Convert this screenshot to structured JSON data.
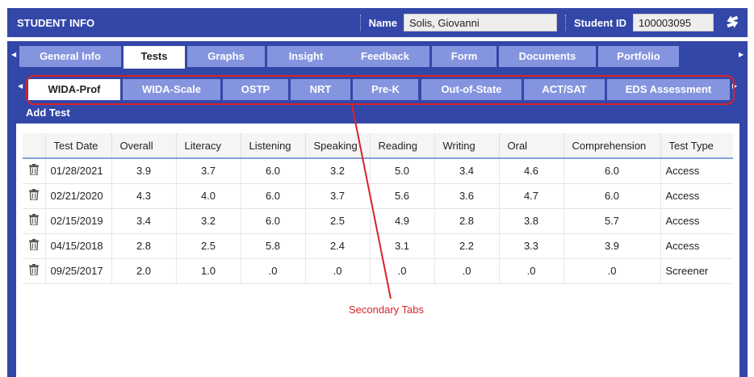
{
  "header": {
    "title": "STUDENT INFO",
    "name_label": "Name",
    "name_value": "Solis, Giovanni",
    "id_label": "Student ID",
    "id_value": "100003095",
    "swap_icon": "swap-icon"
  },
  "outer_tabs": [
    {
      "label": "General Info"
    },
    {
      "label": "Tests"
    },
    {
      "label": "Graphs"
    },
    {
      "label": "Insight"
    },
    {
      "label": "Feedback"
    },
    {
      "label": "Form"
    },
    {
      "label": "Documents"
    },
    {
      "label": "Portfolio"
    }
  ],
  "secondary_tabs": [
    {
      "label": "WIDA-Prof"
    },
    {
      "label": "WIDA-Scale"
    },
    {
      "label": "OSTP"
    },
    {
      "label": "NRT"
    },
    {
      "label": "Pre-K"
    },
    {
      "label": "Out-of-State"
    },
    {
      "label": "ACT/SAT"
    },
    {
      "label": "EDS Assessment"
    }
  ],
  "add_test_label": "Add Test",
  "table": {
    "columns": [
      "Test Date",
      "Overall",
      "Literacy",
      "Listening",
      "Speaking",
      "Reading",
      "Writing",
      "Oral",
      "Comprehension",
      "Test Type"
    ],
    "rows": [
      [
        "01/28/2021",
        "3.9",
        "3.7",
        "6.0",
        "3.2",
        "5.0",
        "3.4",
        "4.6",
        "6.0",
        "Access"
      ],
      [
        "02/21/2020",
        "4.3",
        "4.0",
        "6.0",
        "3.7",
        "5.6",
        "3.6",
        "4.7",
        "6.0",
        "Access"
      ],
      [
        "02/15/2019",
        "3.4",
        "3.2",
        "6.0",
        "2.5",
        "4.9",
        "2.8",
        "3.8",
        "5.7",
        "Access"
      ],
      [
        "04/15/2018",
        "2.8",
        "2.5",
        "5.8",
        "2.4",
        "3.1",
        "2.2",
        "3.3",
        "3.9",
        "Access"
      ],
      [
        "09/25/2017",
        "2.0",
        "1.0",
        ".0",
        ".0",
        ".0",
        ".0",
        ".0",
        ".0",
        "Screener"
      ]
    ]
  },
  "annotation": {
    "label": "Secondary Tabs",
    "color": "#d8232a"
  },
  "colors": {
    "primary": "#3347a8",
    "tab_inactive": "#8594de"
  }
}
